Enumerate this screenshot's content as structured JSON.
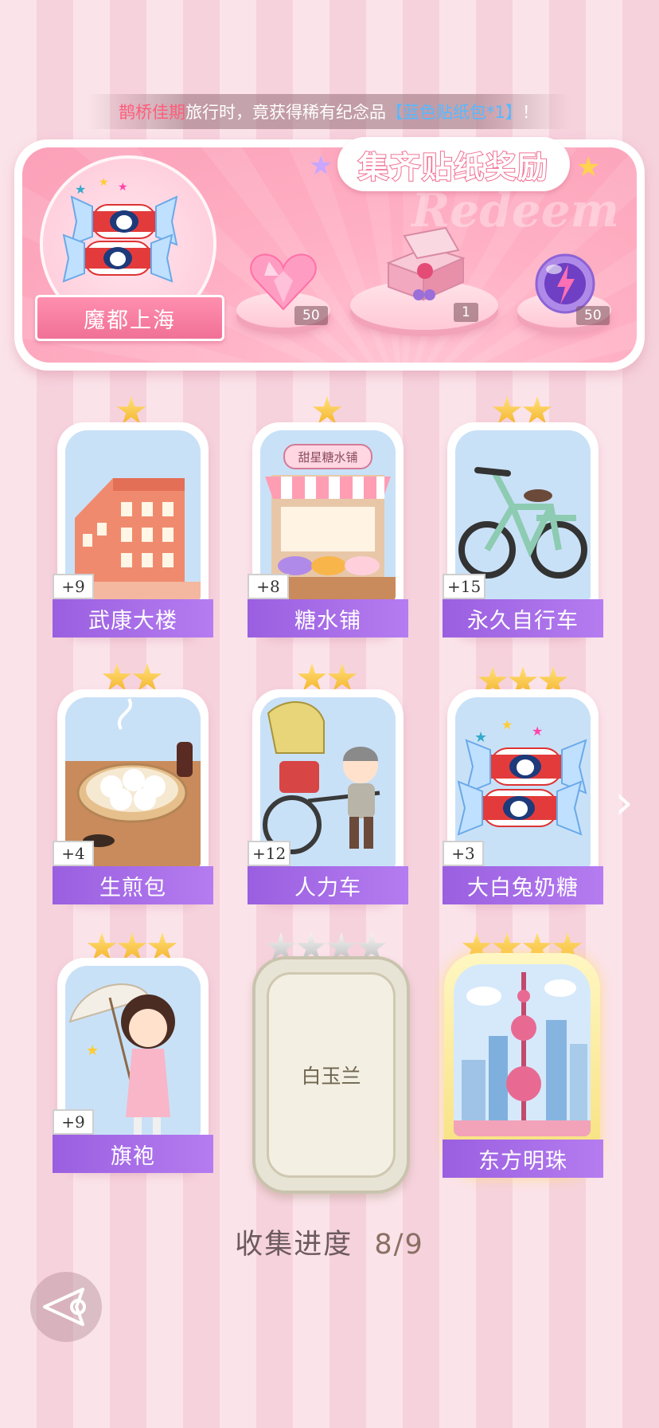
{
  "notice": {
    "player_name": "鹊桥佳期",
    "text_middle": "旅行时，竟获得稀有纪念品",
    "item": "【蓝色贴纸包*1】",
    "text_end": "！"
  },
  "rewards": {
    "title": "集齐贴纸奖励",
    "watermark": "Redeem",
    "city_name": "魔都上海",
    "items": [
      {
        "name": "heart-gem-icon",
        "count": "50"
      },
      {
        "name": "gift-box-icon",
        "count": "1"
      },
      {
        "name": "energy-orb-icon",
        "count": "50"
      }
    ]
  },
  "cards": [
    {
      "name": "武康大楼",
      "bonus": "+9",
      "stars": 1
    },
    {
      "name": "糖水铺",
      "bonus": "+8",
      "stars": 1,
      "shop_sign": "甜星糖水铺"
    },
    {
      "name": "永久自行车",
      "bonus": "+15",
      "stars": 2
    },
    {
      "name": "生煎包",
      "bonus": "+4",
      "stars": 2
    },
    {
      "name": "人力车",
      "bonus": "+12",
      "stars": 2
    },
    {
      "name": "大白兔奶糖",
      "bonus": "+3",
      "stars": 3
    },
    {
      "name": "旗袍",
      "bonus": "+9",
      "stars": 3
    },
    {
      "name": "白玉兰",
      "stars": 4,
      "locked": true
    },
    {
      "name": "东方明珠",
      "stars": 4,
      "golden": true
    }
  ],
  "progress": {
    "label": "收集进度",
    "value": "8/9"
  },
  "colors": {
    "accent_pink": "#f06f93",
    "label_purple": "#a66be8",
    "star_gold": "#f4b22a"
  }
}
